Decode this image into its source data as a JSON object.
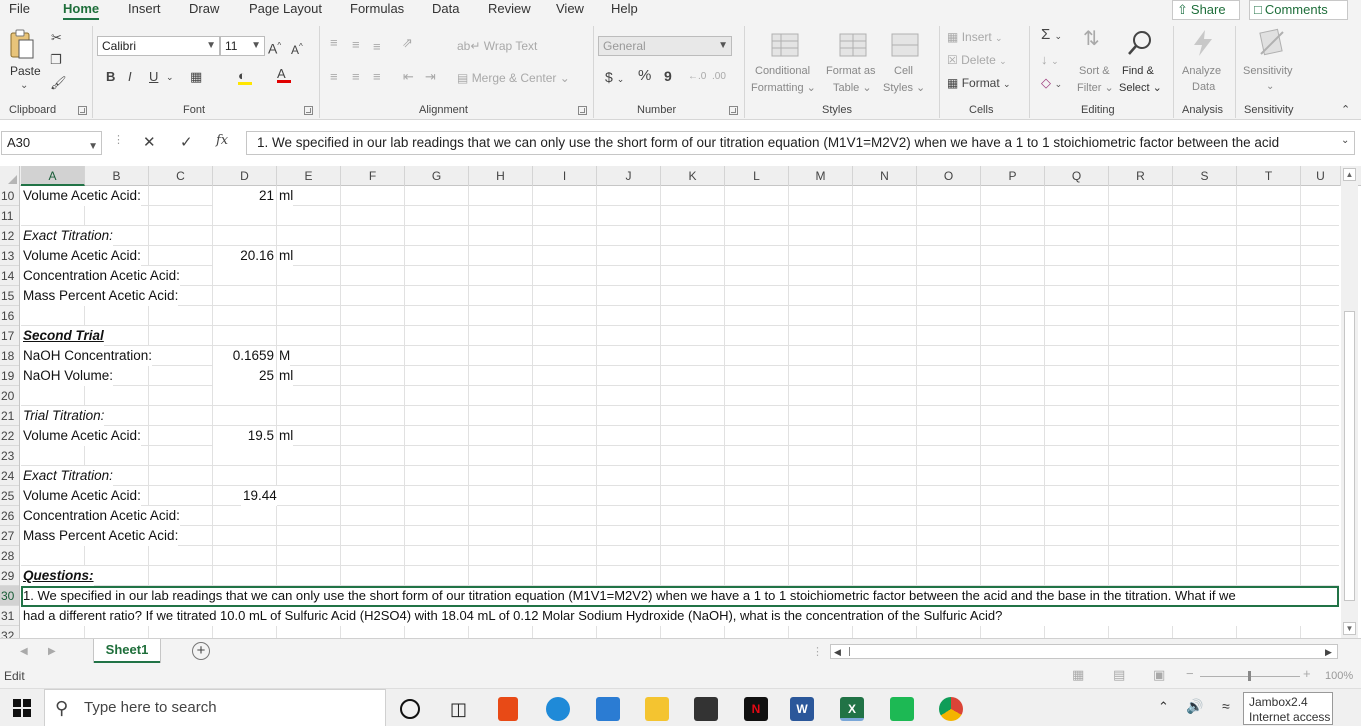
{
  "ribbon_tabs": [
    "File",
    "Home",
    "Insert",
    "Draw",
    "Page Layout",
    "Formulas",
    "Data",
    "Review",
    "View",
    "Help"
  ],
  "top_buttons": {
    "share": "Share",
    "comments": "Comments"
  },
  "ribbon": {
    "clipboard": {
      "paste": "Paste",
      "group": "Clipboard"
    },
    "font": {
      "name": "Calibri",
      "size": "11",
      "bold": "B",
      "italic": "I",
      "underline": "U",
      "group": "Font",
      "grow": "A^",
      "shrink": "A^"
    },
    "alignment": {
      "wrap_text": "Wrap Text",
      "merge_center": "Merge & Center",
      "group": "Alignment"
    },
    "number": {
      "format": "General",
      "currency": "$",
      "percent": "%",
      "comma": "9",
      "group": "Number"
    },
    "styles": {
      "conditional_1": "Conditional",
      "conditional_2": "Formatting",
      "format_as_1": "Format as",
      "format_as_2": "Table",
      "cell_styles_1": "Cell",
      "cell_styles_2": "Styles",
      "group": "Styles"
    },
    "cells": {
      "insert": "Insert",
      "delete": "Delete",
      "format": "Format",
      "group": "Cells"
    },
    "editing": {
      "sort_1": "Sort &",
      "sort_2": "Filter",
      "find_1": "Find &",
      "find_2": "Select",
      "group": "Editing"
    },
    "analysis": {
      "label_1": "Analyze",
      "label_2": "Data",
      "group": "Analysis"
    },
    "sensitivity": {
      "label": "Sensitivity",
      "group": "Sensitivity"
    }
  },
  "formula_bar": {
    "name_box": "A30",
    "fx": "fx",
    "content": "1. We specified in our lab readings that we can only use the short form of our titration equation (M1V1=M2V2) when we have a 1 to 1 stoichiometric factor between the acid"
  },
  "columns": [
    "A",
    "B",
    "C",
    "D",
    "E",
    "F",
    "G",
    "H",
    "I",
    "J",
    "K",
    "L",
    "M",
    "N",
    "O",
    "P",
    "Q",
    "R",
    "S",
    "T",
    "U"
  ],
  "rows": [
    "10",
    "11",
    "12",
    "13",
    "14",
    "15",
    "16",
    "17",
    "18",
    "19",
    "20",
    "21",
    "22",
    "23",
    "24",
    "25",
    "26",
    "27",
    "28",
    "29",
    "30",
    "31",
    "32"
  ],
  "cells": {
    "a10": "Volume Acetic Acid:",
    "d10": "21",
    "e10": "ml",
    "a12": "Exact Titration:",
    "a13": "Volume Acetic Acid:",
    "d13": "20.16",
    "e13": "ml",
    "a14": "Concentration Acetic Acid:",
    "a15": "Mass Percent Acetic Acid:",
    "a17": "Second Trial",
    "a18": "NaOH Concentration:",
    "d18": "0.1659",
    "e18": "M",
    "a19": "NaOH Volume:",
    "d19": "25",
    "e19": "ml",
    "a21": "Trial Titration:",
    "a22": "Volume Acetic Acid:",
    "d22": "19.5",
    "e22": "ml",
    "a24": "Exact Titration:",
    "a25": "Volume Acetic Acid:",
    "d25": "19.44",
    "a26": "Concentration Acetic Acid:",
    "a27": "Mass Percent Acetic Acid:",
    "a29": "Questions:",
    "a30": "1. We specified in our lab readings that we can only use the short form of our titration equation (M1V1=M2V2) when we have a 1 to 1 stoichiometric factor between the acid and the base in the titration.  What if we",
    "a31": "had a different ratio?  If we titrated 10.0 mL of Sulfuric Acid (H2SO4)  with 18.04 mL of 0.12 Molar Sodium Hydroxide (NaOH), what is the concentration of the Sulfuric Acid?"
  },
  "sheet_tabs": [
    "Sheet1"
  ],
  "status": {
    "mode": "Edit",
    "zoom": "100%"
  },
  "taskbar": {
    "search_placeholder": "Type here to search",
    "network_name": "Jambox2.4",
    "network_status": "Internet access"
  },
  "colors": {
    "excel_green": "#217346",
    "accent_text": "#1e6e3a"
  }
}
